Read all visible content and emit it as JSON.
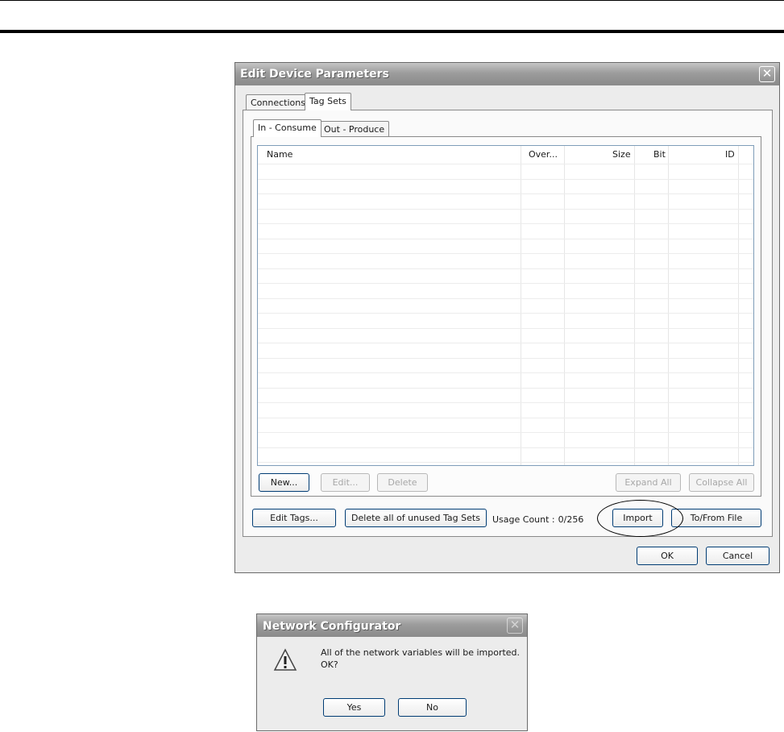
{
  "edit_dialog": {
    "title": "Edit Device Parameters",
    "tabs": [
      "Connections",
      "Tag Sets"
    ],
    "subtabs": [
      "In - Consume",
      "Out - Produce"
    ],
    "columns": [
      "Name",
      "Over...",
      "Size",
      "Bit",
      "ID"
    ],
    "buttons": {
      "new": "New...",
      "edit": "Edit...",
      "delete": "Delete",
      "expand_all": "Expand All",
      "collapse_all": "Collapse All",
      "edit_tags": "Edit Tags...",
      "delete_unused": "Delete all of unused Tag Sets",
      "import": "Import",
      "to_from_file": "To/From File",
      "ok": "OK",
      "cancel": "Cancel"
    },
    "usage_label": "Usage Count :",
    "usage_value": "0/256"
  },
  "message_box": {
    "title": "Network Configurator",
    "line1": "All of the network variables will be imported.",
    "line2": "OK?",
    "yes": "Yes",
    "no": "No"
  },
  "icons": {
    "close": "close-icon",
    "warning": "warning-icon"
  },
  "colors": {
    "titlebar": "#9c9c9c",
    "button_border": "#003c74",
    "list_border": "#7f9db9"
  }
}
